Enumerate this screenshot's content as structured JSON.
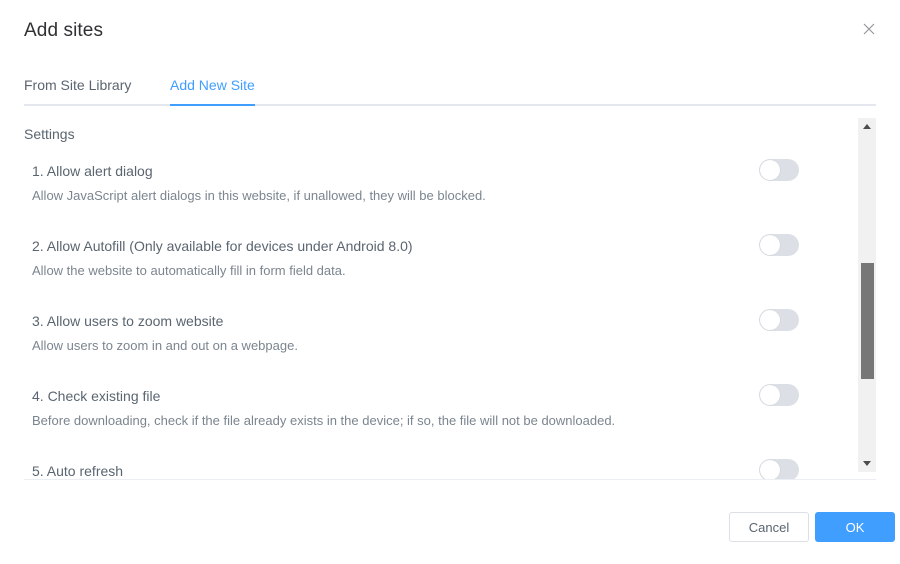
{
  "dialog": {
    "title": "Add sites",
    "close_icon": "close-icon"
  },
  "tabs": [
    {
      "label": "From Site Library",
      "active": false
    },
    {
      "label": "Add New Site",
      "active": true
    }
  ],
  "settings": {
    "section_label": "Settings",
    "items": [
      {
        "title": "1. Allow alert dialog",
        "description": "Allow JavaScript alert dialogs in this website, if unallowed, they will be blocked.",
        "toggle_on": false
      },
      {
        "title": "2. Allow Autofill (Only available for devices under Android 8.0)",
        "description": "Allow the website to automatically fill in form field data.",
        "toggle_on": false
      },
      {
        "title": "3. Allow users to zoom website",
        "description": "Allow users to zoom in and out on a webpage.",
        "toggle_on": false
      },
      {
        "title": "4. Check existing file",
        "description": "Before downloading, check if the file already exists in the device; if so, the file will not be downloaded.",
        "toggle_on": false
      },
      {
        "title": "5. Auto refresh",
        "description": "",
        "toggle_on": false
      }
    ]
  },
  "scrollbar": {
    "up_icon": "triangle-up-icon",
    "down_icon": "triangle-down-icon"
  },
  "footer": {
    "cancel_label": "Cancel",
    "ok_label": "OK"
  },
  "colors": {
    "accent": "#409eff",
    "text_primary": "#303133",
    "text_regular": "#5a6570",
    "text_secondary": "#7b858f",
    "border": "#dcdfe6",
    "toggle_off_track": "#dcdfe6",
    "scroll_thumb": "#777777"
  }
}
